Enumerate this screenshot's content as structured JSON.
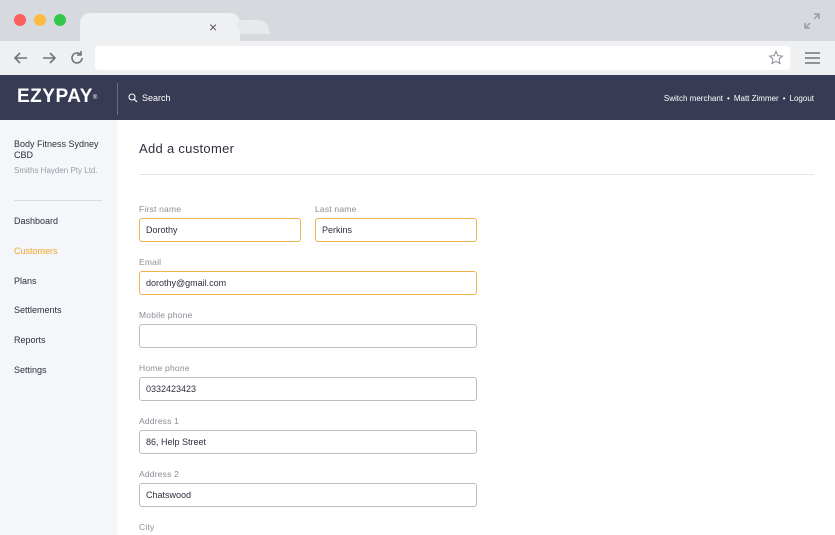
{
  "browser": {
    "tab_close_glyph": "×",
    "icons": [
      "back-arrow-icon",
      "forward-arrow-icon",
      "reload-icon",
      "star-icon",
      "hamburger-menu-icon",
      "expand-icon"
    ]
  },
  "header": {
    "brand": "EZYPAY",
    "brand_mark": "®",
    "search_label": "Search",
    "links": [
      "Switch merchant",
      "Matt Zimmer",
      "Logout"
    ],
    "separator": "•",
    "background": "#383b54"
  },
  "sidebar": {
    "merchant_name": "Body Fitness Sydney CBD",
    "company_name": "Smiths Hayden Pty Ltd.",
    "items": [
      {
        "label": "Dashboard",
        "active": false
      },
      {
        "label": "Customers",
        "active": true
      },
      {
        "label": "Plans",
        "active": false
      },
      {
        "label": "Settlements",
        "active": false
      },
      {
        "label": "Reports",
        "active": false
      },
      {
        "label": "Settings",
        "active": false
      }
    ],
    "active_color": "#f0a62a"
  },
  "main": {
    "title": "Add a customer",
    "fields": {
      "first_name": {
        "label": "First name",
        "value": "Dorothy"
      },
      "last_name": {
        "label": "Last name",
        "value": "Perkins"
      },
      "email": {
        "label": "Email",
        "value": "dorothy@gmail.com"
      },
      "mobile_phone": {
        "label": "Mobile phone",
        "value": ""
      },
      "home_phone": {
        "label": "Home phone",
        "value": "0332423423"
      },
      "address1": {
        "label": "Address 1",
        "value": "86, Help Street"
      },
      "address2": {
        "label": "Address 2",
        "value": "Chatswood"
      },
      "city": {
        "label": "City"
      }
    },
    "focus_color": "#f0b24a"
  }
}
